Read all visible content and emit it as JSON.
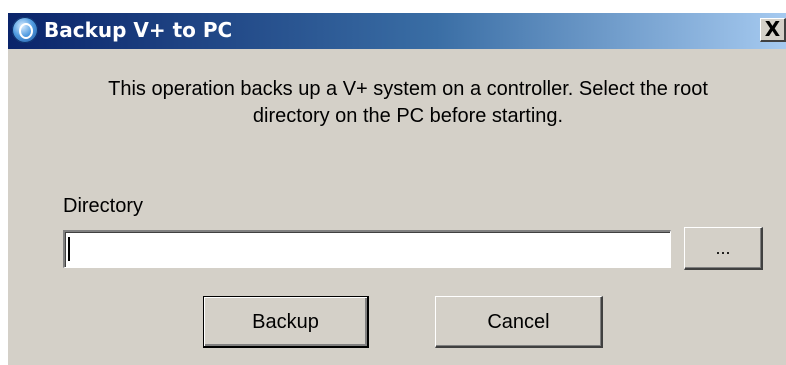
{
  "window": {
    "title": "Backup V+ to PC",
    "close_label": "X"
  },
  "dialog": {
    "description": "This operation backs up a V+ system on a controller. Select the root directory on the PC before starting.",
    "directory_label": "Directory",
    "directory_value": "",
    "browse_label": "...",
    "backup_label": "Backup",
    "cancel_label": "Cancel"
  },
  "colors": {
    "titlebar_start": "#0a246a",
    "titlebar_end": "#a6caf0",
    "dialog_face": "#d4d0c8"
  }
}
